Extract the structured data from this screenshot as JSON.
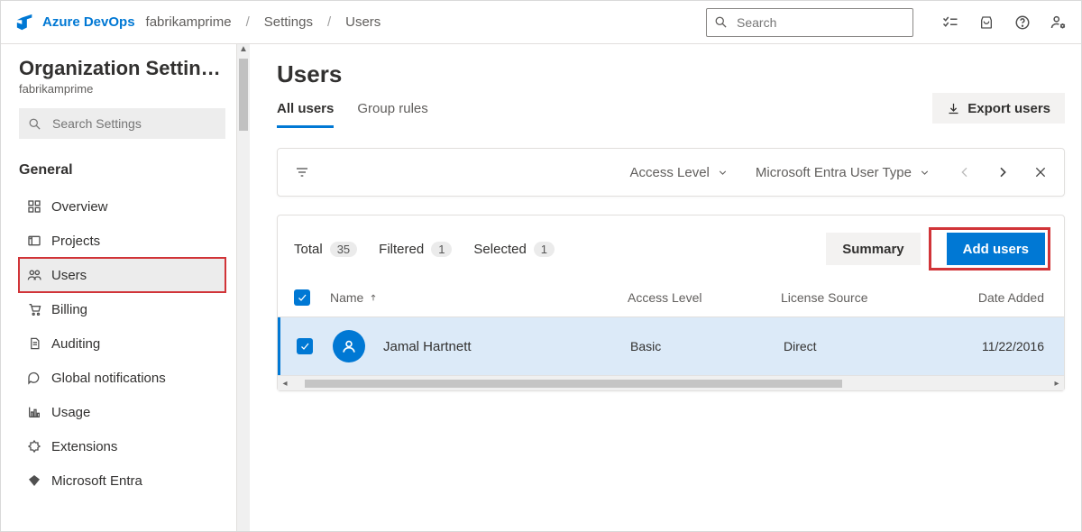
{
  "header": {
    "brand": "Azure DevOps",
    "crumbs": [
      "fabrikamprime",
      "Settings",
      "Users"
    ],
    "search_placeholder": "Search"
  },
  "sidebar": {
    "title": "Organization Settin…",
    "subtitle": "fabrikamprime",
    "search_placeholder": "Search Settings",
    "section": "General",
    "items": [
      {
        "label": "Overview"
      },
      {
        "label": "Projects"
      },
      {
        "label": "Users"
      },
      {
        "label": "Billing"
      },
      {
        "label": "Auditing"
      },
      {
        "label": "Global notifications"
      },
      {
        "label": "Usage"
      },
      {
        "label": "Extensions"
      },
      {
        "label": "Microsoft Entra"
      }
    ]
  },
  "main": {
    "title": "Users",
    "tabs": [
      {
        "label": "All users",
        "active": true
      },
      {
        "label": "Group rules",
        "active": false
      }
    ],
    "export_label": "Export users",
    "filters": {
      "access_level": "Access Level",
      "entra_type": "Microsoft Entra User Type"
    },
    "stats": {
      "total_label": "Total",
      "total": "35",
      "filtered_label": "Filtered",
      "filtered": "1",
      "selected_label": "Selected",
      "selected": "1"
    },
    "summary_label": "Summary",
    "add_users_label": "Add users",
    "columns": {
      "name": "Name",
      "access": "Access Level",
      "source": "License Source",
      "date": "Date Added"
    },
    "rows": [
      {
        "name": "Jamal Hartnett",
        "access": "Basic",
        "source": "Direct",
        "date": "11/22/2016"
      }
    ]
  }
}
